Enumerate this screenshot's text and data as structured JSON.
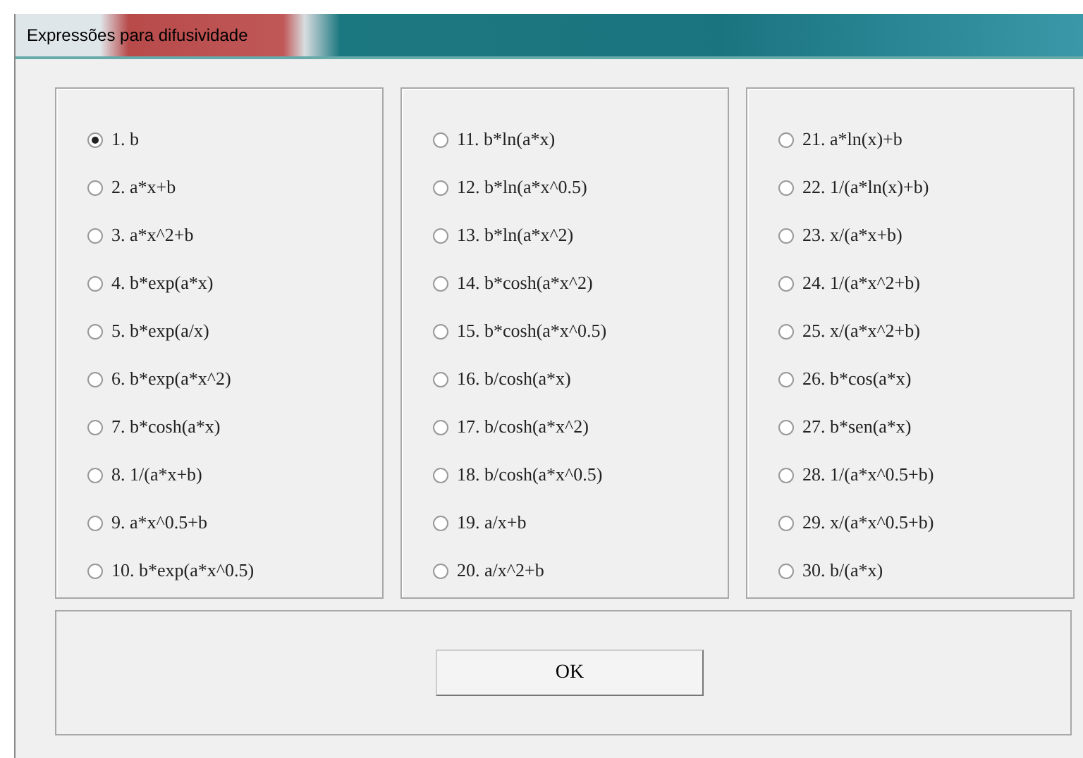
{
  "window": {
    "title": "Expressões para difusividade"
  },
  "groups": [
    {
      "options": [
        {
          "label": "1. b",
          "selected": true
        },
        {
          "label": "2. a*x+b",
          "selected": false
        },
        {
          "label": "3. a*x^2+b",
          "selected": false
        },
        {
          "label": "4. b*exp(a*x)",
          "selected": false
        },
        {
          "label": "5. b*exp(a/x)",
          "selected": false
        },
        {
          "label": "6. b*exp(a*x^2)",
          "selected": false
        },
        {
          "label": "7. b*cosh(a*x)",
          "selected": false
        },
        {
          "label": "8. 1/(a*x+b)",
          "selected": false
        },
        {
          "label": "9. a*x^0.5+b",
          "selected": false
        },
        {
          "label": "10. b*exp(a*x^0.5)",
          "selected": false
        }
      ]
    },
    {
      "options": [
        {
          "label": "11. b*ln(a*x)",
          "selected": false
        },
        {
          "label": "12. b*ln(a*x^0.5)",
          "selected": false
        },
        {
          "label": "13. b*ln(a*x^2)",
          "selected": false
        },
        {
          "label": "14. b*cosh(a*x^2)",
          "selected": false
        },
        {
          "label": "15. b*cosh(a*x^0.5)",
          "selected": false
        },
        {
          "label": "16. b/cosh(a*x)",
          "selected": false
        },
        {
          "label": "17. b/cosh(a*x^2)",
          "selected": false
        },
        {
          "label": "18. b/cosh(a*x^0.5)",
          "selected": false
        },
        {
          "label": "19. a/x+b",
          "selected": false
        },
        {
          "label": "20. a/x^2+b",
          "selected": false
        }
      ]
    },
    {
      "options": [
        {
          "label": "21. a*ln(x)+b",
          "selected": false
        },
        {
          "label": "22. 1/(a*ln(x)+b)",
          "selected": false
        },
        {
          "label": "23. x/(a*x+b)",
          "selected": false
        },
        {
          "label": "24. 1/(a*x^2+b)",
          "selected": false
        },
        {
          "label": "25. x/(a*x^2+b)",
          "selected": false
        },
        {
          "label": "26. b*cos(a*x)",
          "selected": false
        },
        {
          "label": "27. b*sen(a*x)",
          "selected": false
        },
        {
          "label": "28. 1/(a*x^0.5+b)",
          "selected": false
        },
        {
          "label": "29. x/(a*x^0.5+b)",
          "selected": false
        },
        {
          "label": "30. b/(a*x)",
          "selected": false
        }
      ]
    }
  ],
  "buttons": [
    "OK"
  ]
}
